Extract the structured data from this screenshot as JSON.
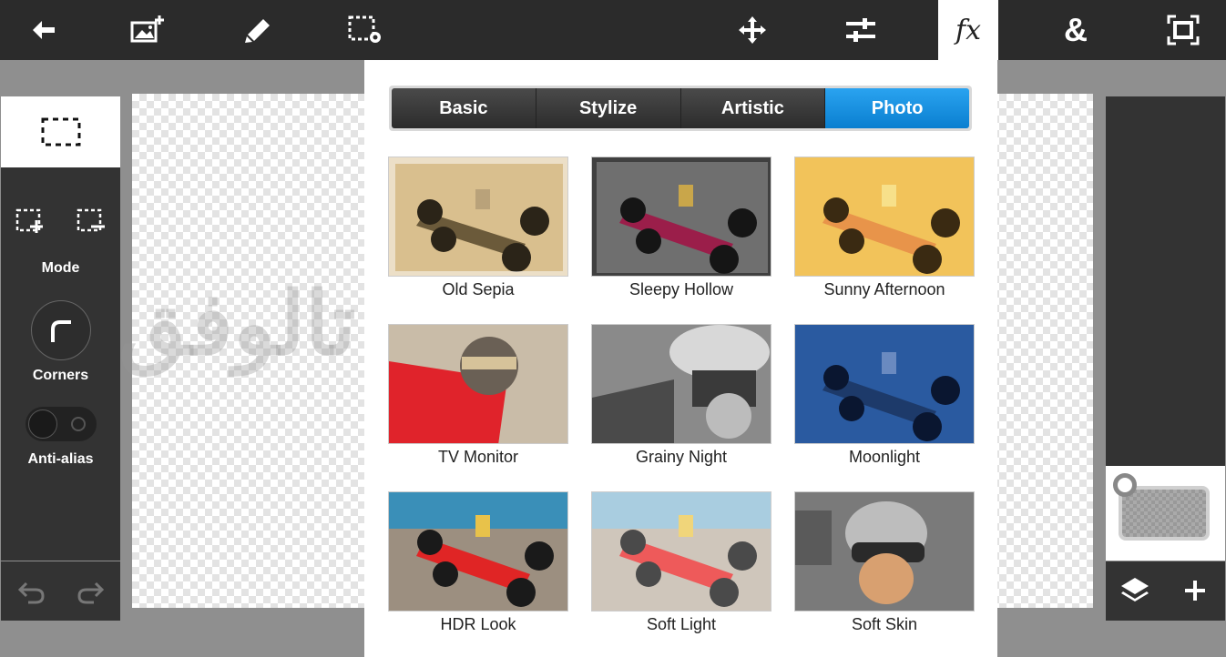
{
  "toolbar": {
    "items": [
      {
        "name": "back-arrow-icon"
      },
      {
        "name": "add-image-icon"
      },
      {
        "name": "brush-icon"
      },
      {
        "name": "selection-settings-icon"
      },
      {
        "name": "move-icon"
      },
      {
        "name": "adjustments-icon"
      },
      {
        "name": "effects-fx-icon",
        "label": "fx",
        "active": true
      },
      {
        "name": "blend-ampersand-icon",
        "label": "&"
      },
      {
        "name": "fit-screen-icon"
      }
    ]
  },
  "left_panel": {
    "mode_label": "Mode",
    "corners_label": "Corners",
    "antialias_label": "Anti-alias"
  },
  "watermark": "تالوفق",
  "effects": {
    "tabs": [
      {
        "label": "Basic",
        "active": false
      },
      {
        "label": "Stylize",
        "active": false
      },
      {
        "label": "Artistic",
        "active": false
      },
      {
        "label": "Photo",
        "active": true
      }
    ],
    "filters": [
      {
        "label": "Old Sepia"
      },
      {
        "label": "Sleepy Hollow"
      },
      {
        "label": "Sunny Afternoon"
      },
      {
        "label": "TV Monitor"
      },
      {
        "label": "Grainy Night"
      },
      {
        "label": "Moonlight"
      },
      {
        "label": "HDR Look"
      },
      {
        "label": "Soft Light"
      },
      {
        "label": "Soft Skin"
      }
    ]
  },
  "colors": {
    "toolbar_bg": "#2b2b2b",
    "panel_bg": "#333333",
    "accent": "#1a8fe0",
    "canvas_bg": "#8f8f8f"
  }
}
